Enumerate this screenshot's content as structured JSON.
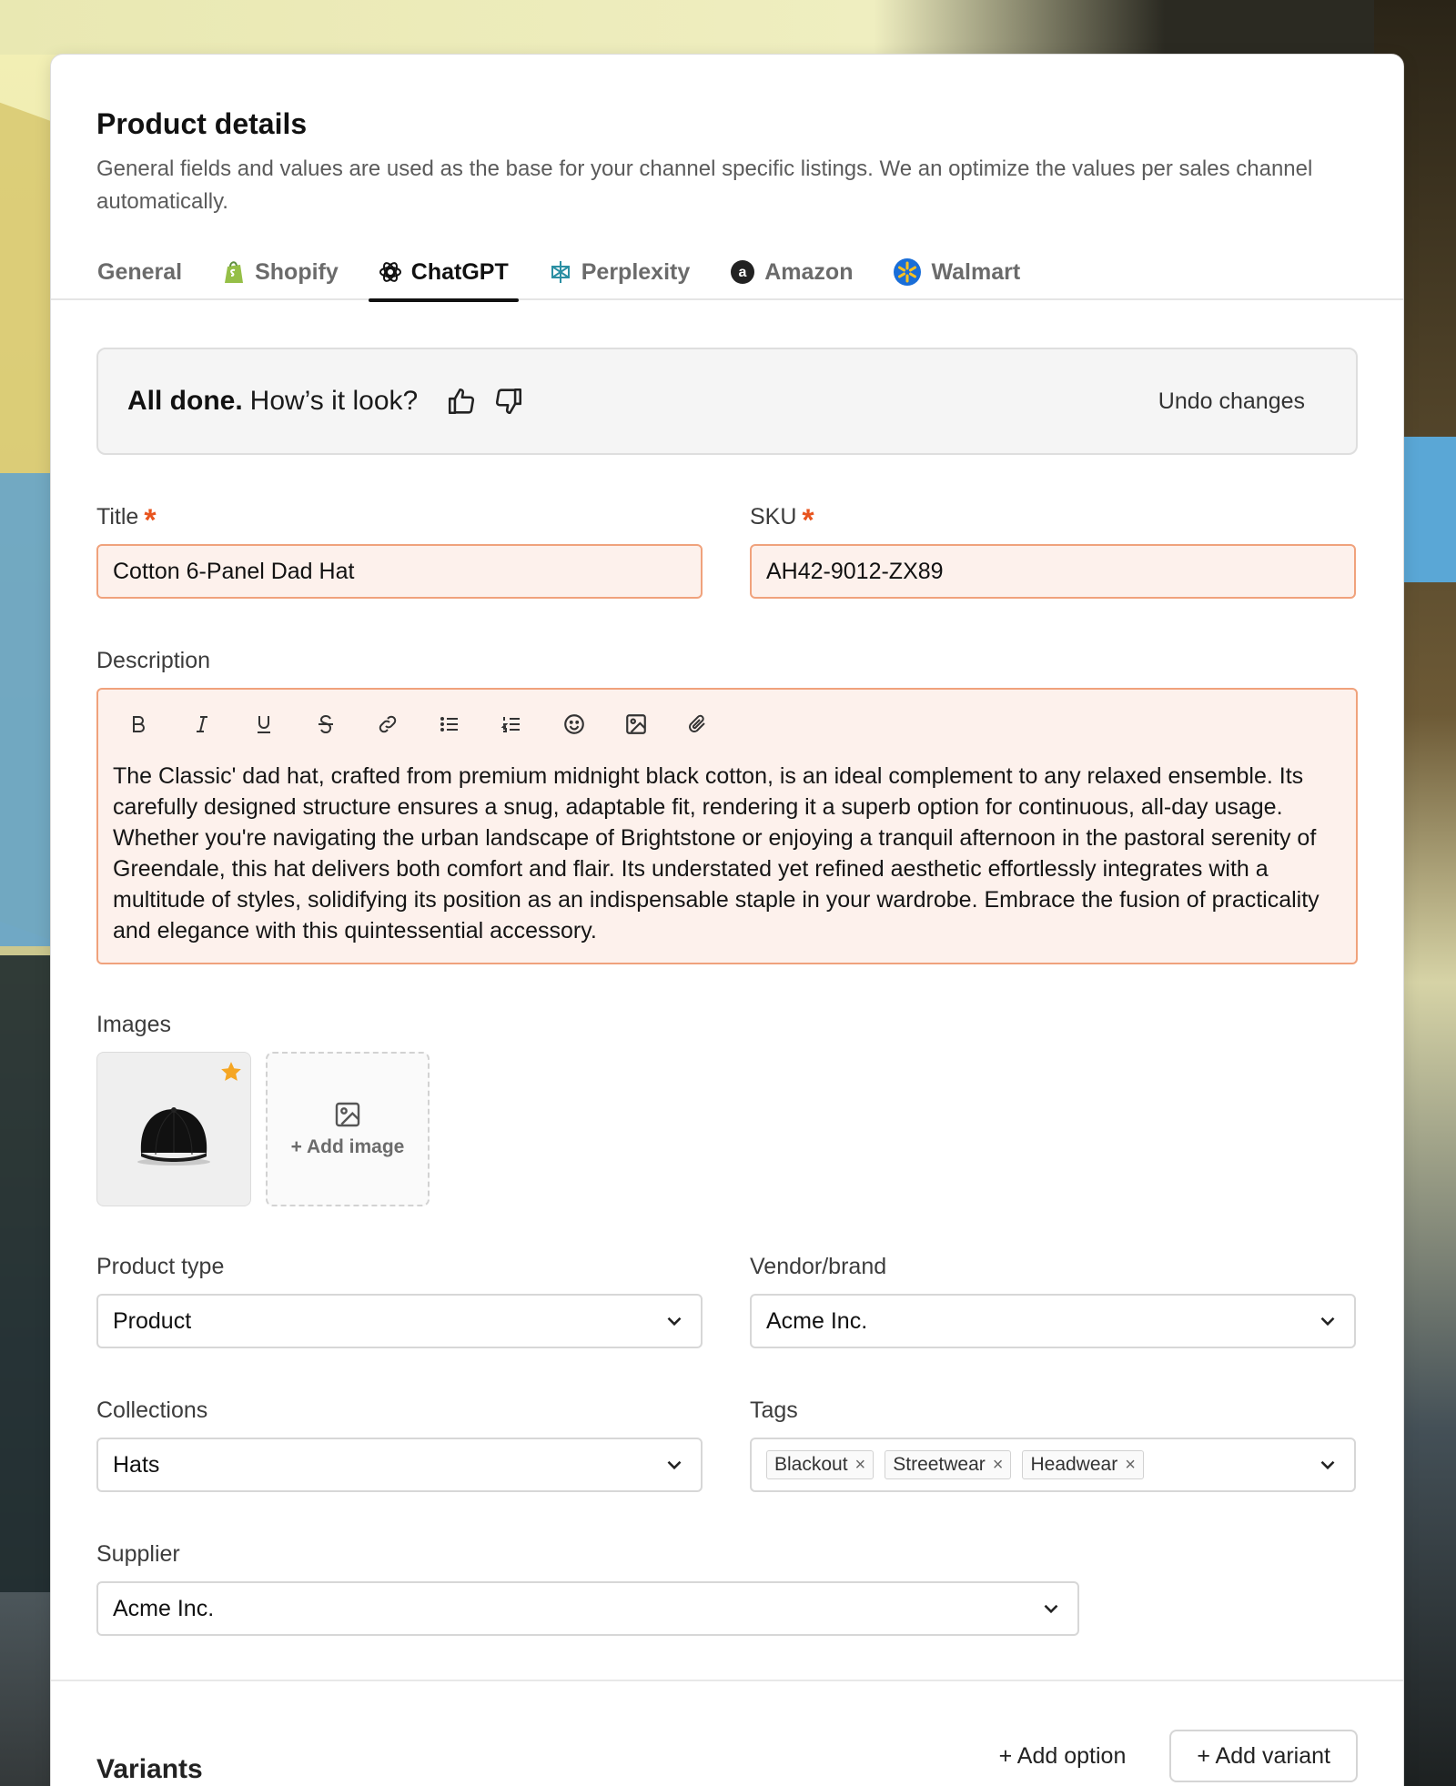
{
  "colors": {
    "accent": "#111111",
    "required": "#e8541e",
    "ai_field_border": "#f0a27c",
    "ai_field_bg": "#fdf1ec",
    "star": "#f5a623"
  },
  "header": {
    "title": "Product details",
    "subtitle": "General fields and values are used as the base for your channel specific listings. We an optimize the values per sales channel automatically."
  },
  "tabs": [
    {
      "label": "General",
      "icon": null,
      "active": false
    },
    {
      "label": "Shopify",
      "icon": "shopify-icon",
      "active": false
    },
    {
      "label": "ChatGPT",
      "icon": "chatgpt-icon",
      "active": true
    },
    {
      "label": "Perplexity",
      "icon": "perplexity-icon",
      "active": false
    },
    {
      "label": "Amazon",
      "icon": "amazon-icon",
      "active": false
    },
    {
      "label": "Walmart",
      "icon": "walmart-icon",
      "active": false
    }
  ],
  "banner": {
    "strong": "All done.",
    "question": "How’s it look?",
    "undo_label": "Undo changes"
  },
  "fields": {
    "title": {
      "label": "Title",
      "value": "Cotton 6-Panel Dad Hat"
    },
    "sku": {
      "label": "SKU",
      "value": "AH42-9012-ZX89"
    },
    "description": {
      "label": "Description",
      "value": "The  Classic' dad hat, crafted from premium midnight black cotton, is an ideal complement to any relaxed ensemble. Its carefully designed structure ensures a snug, adaptable fit, rendering it a superb option for continuous, all-day usage. Whether you're navigating the urban landscape of Brightstone or enjoying a tranquil afternoon in the pastoral serenity of Greendale, this hat delivers both comfort and flair. Its understated yet refined aesthetic effortlessly integrates with a multitude of styles, solidifying its position as an indispensable staple in your wardrobe. Embrace the fusion of practicality and elegance with this quintessential accessory.",
      "toolbar": [
        "bold-icon",
        "italic-icon",
        "underline-icon",
        "strikethrough-icon",
        "link-icon",
        "bullet-list-icon",
        "numbered-list-icon",
        "emoji-icon",
        "image-icon",
        "attachment-icon"
      ]
    },
    "images": {
      "label": "Images",
      "add_label": "+ Add image"
    },
    "product_type": {
      "label": "Product type",
      "value": "Product"
    },
    "vendor": {
      "label": "Vendor/brand",
      "value": "Acme Inc."
    },
    "collections": {
      "label": "Collections",
      "value": "Hats"
    },
    "tags": {
      "label": "Tags",
      "values": [
        "Blackout",
        "Streetwear",
        "Headwear"
      ],
      "remove_glyph": "×"
    },
    "supplier": {
      "label": "Supplier",
      "value": "Acme Inc."
    }
  },
  "variants": {
    "title": "Variants",
    "add_option": "+ Add option",
    "add_variant": "+ Add variant"
  }
}
